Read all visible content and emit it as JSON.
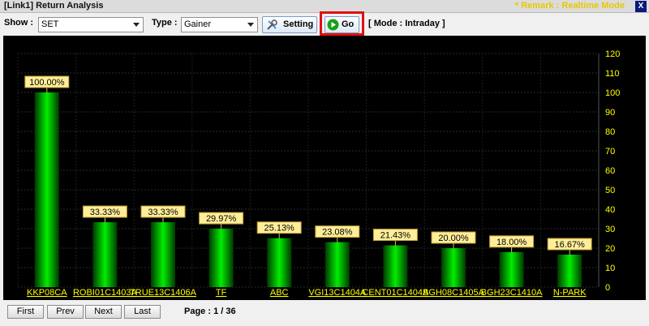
{
  "window": {
    "title": "[Link1] Return Analysis",
    "remark": "* Remark : Realtime Mode",
    "close_label": "X"
  },
  "toolbar": {
    "show_label": "Show :",
    "show_value": "SET",
    "type_label": "Type :",
    "type_value": "Gainer",
    "setting_label": "Setting",
    "go_label": "Go",
    "mode_text": "[ Mode : Intraday ]"
  },
  "icons": {
    "setting": "tools-icon",
    "go": "play-circle-icon",
    "close": "close-icon"
  },
  "colors": {
    "bar": "#00dd00",
    "label_bg": "#ffee99",
    "axis_text": "#ffff00",
    "remark": "#e8c800",
    "highlight": "#e01010",
    "close_bg": "#0a1a7a"
  },
  "chart_data": {
    "type": "bar",
    "categories": [
      "KKP08CA",
      "ROBI01C1403A",
      "TRUE13C1406A",
      "TF",
      "ABC",
      "VGI13C1404A",
      "CENT01C1404A",
      "BGH08C1405A",
      "BGH23C1410A",
      "N-PARK"
    ],
    "values": [
      100.0,
      33.33,
      33.33,
      29.97,
      25.13,
      23.08,
      21.43,
      20.0,
      18.0,
      16.67
    ],
    "data_labels": [
      "100.00%",
      "33.33%",
      "33.33%",
      "29.97%",
      "25.13%",
      "23.08%",
      "21.43%",
      "20.00%",
      "18.00%",
      "16.67%"
    ],
    "y_ticks": [
      0,
      10,
      20,
      30,
      40,
      50,
      60,
      70,
      80,
      90,
      100,
      110,
      120
    ],
    "ylim": [
      0,
      120
    ],
    "y_axis_side": "right",
    "grid": true
  },
  "footer": {
    "first_label": "First",
    "prev_label": "Prev",
    "next_label": "Next",
    "last_label": "Last",
    "page_text": "Page : 1 / 36"
  }
}
